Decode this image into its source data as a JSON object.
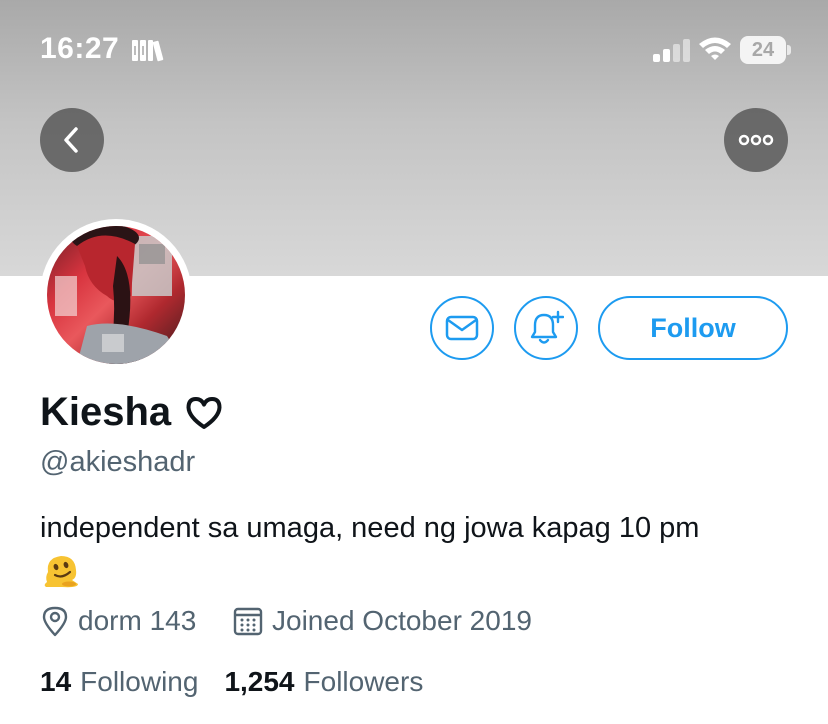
{
  "status_bar": {
    "time": "16:27",
    "battery": "24",
    "icons": [
      "books-icon",
      "signal-icon",
      "wifi-icon",
      "battery-icon"
    ]
  },
  "header": {
    "back_icon": "chevron-left-icon",
    "more_icon": "ellipsis-icon"
  },
  "profile": {
    "display_name": "Kiesha",
    "name_icon": "heart-outline-icon",
    "handle": "@akieshadr",
    "bio": "independent sa umaga, need ng jowa kapag 10 pm",
    "bio_emoji": "melting-face-emoji",
    "location": "dorm 143",
    "joined": "Joined October 2019",
    "following_count": "14",
    "following_label": "Following",
    "followers_count": "1,254",
    "followers_label": "Followers"
  },
  "actions": {
    "message_icon": "mail-icon",
    "notify_icon": "bell-plus-icon",
    "follow_label": "Follow"
  },
  "colors": {
    "accent": "#1d9bf0",
    "secondary_text": "#536471",
    "primary_text": "#0f1419"
  }
}
